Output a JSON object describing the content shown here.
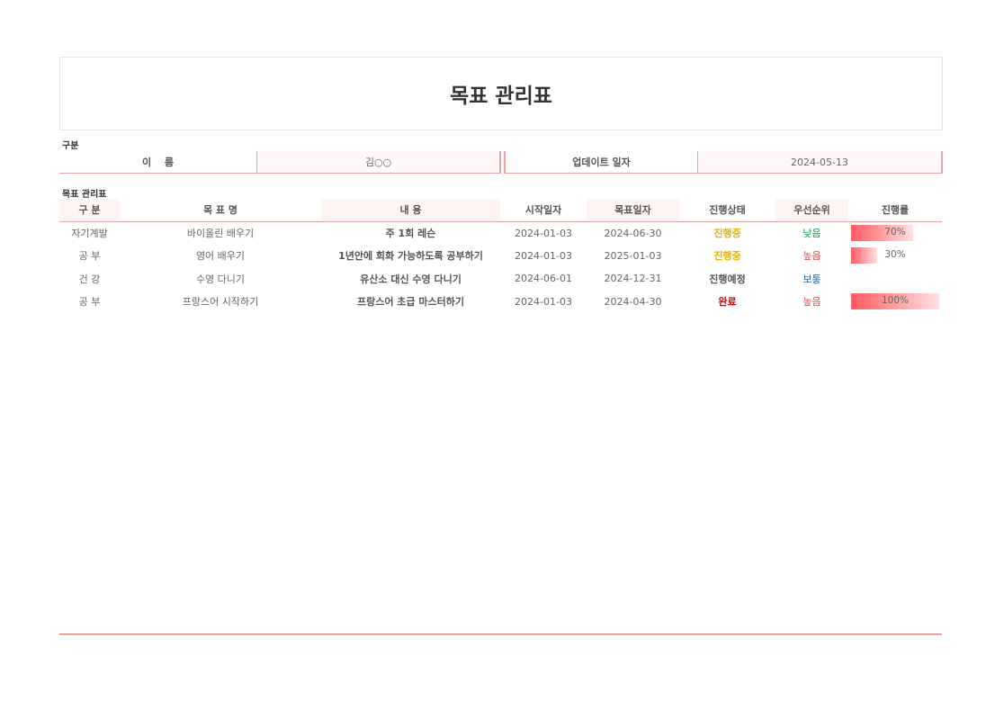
{
  "title": "목표 관리표",
  "section1": "구분",
  "info": {
    "name_label": "이　 름",
    "name_value": "김○○",
    "date_label": "업데이트 일자",
    "date_value": "2024-05-13"
  },
  "section2": "목표 관리표",
  "headers": [
    "구 분",
    "목 표 명",
    "내 용",
    "시작일자",
    "목표일자",
    "진행상태",
    "우선순위",
    "진행률"
  ],
  "rows": [
    {
      "cat": "자기계발",
      "goal": "바이올린 배우기",
      "desc": "주 1회 레슨",
      "start": "2024-01-03",
      "end": "2024-06-30",
      "status": "진행중",
      "status_color": "#e0b400",
      "priority": "낮음",
      "priority_color": "#1a9a50",
      "progress": 70,
      "progress_label": "70%"
    },
    {
      "cat": "공 부",
      "goal": "영어 배우기",
      "desc": "1년안에 회화 가능하도록 공부하기",
      "start": "2024-01-03",
      "end": "2025-01-03",
      "status": "진행중",
      "status_color": "#e0b400",
      "priority": "높음",
      "priority_color": "#e05050",
      "progress": 30,
      "progress_label": "30%"
    },
    {
      "cat": "건 강",
      "goal": "수영 다니기",
      "desc": "유산소 대신 수영 다니기",
      "start": "2024-06-01",
      "end": "2024-12-31",
      "status": "진행예정",
      "status_color": "#555555",
      "priority": "보통",
      "priority_color": "#1a5fa0",
      "progress": 0,
      "progress_label": ""
    },
    {
      "cat": "공 부",
      "goal": "프랑스어 시작하기",
      "desc": "프랑스어 초급 마스터하기",
      "start": "2024-01-03",
      "end": "2024-04-30",
      "status": "완료",
      "status_color": "#cc0000",
      "priority": "높음",
      "priority_color": "#e05050",
      "progress": 100,
      "progress_label": "100%"
    }
  ]
}
